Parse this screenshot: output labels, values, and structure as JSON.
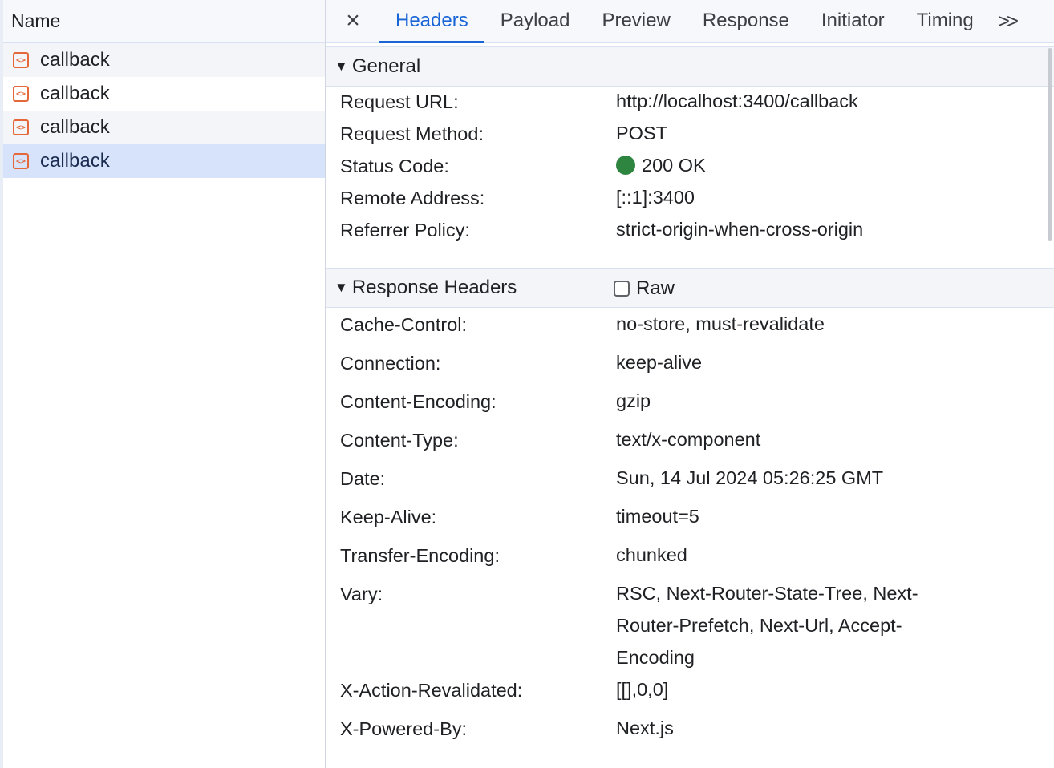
{
  "request_list": {
    "header": "Name",
    "items": [
      {
        "name": "callback",
        "icon": "document-icon"
      },
      {
        "name": "callback",
        "icon": "document-icon"
      },
      {
        "name": "callback",
        "icon": "document-icon"
      },
      {
        "name": "callback",
        "icon": "document-icon",
        "selected": true
      }
    ]
  },
  "tabs": {
    "close_icon": "×",
    "items": [
      "Headers",
      "Payload",
      "Preview",
      "Response",
      "Initiator",
      "Timing"
    ],
    "active": "Headers",
    "more_icon": ">>"
  },
  "general": {
    "title": "General",
    "rows": [
      {
        "key": "Request URL:",
        "value": "http://localhost:3400/callback"
      },
      {
        "key": "Request Method:",
        "value": "POST"
      },
      {
        "key": "Status Code:",
        "value": "200 OK",
        "status_color": "#2e8540"
      },
      {
        "key": "Remote Address:",
        "value": "[::1]:3400"
      },
      {
        "key": "Referrer Policy:",
        "value": "strict-origin-when-cross-origin"
      }
    ]
  },
  "response_headers": {
    "title": "Response Headers",
    "raw_label": "Raw",
    "raw_checked": false,
    "rows": [
      {
        "key": "Cache-Control:",
        "value": "no-store, must-revalidate"
      },
      {
        "key": "Connection:",
        "value": "keep-alive"
      },
      {
        "key": "Content-Encoding:",
        "value": "gzip"
      },
      {
        "key": "Content-Type:",
        "value": "text/x-component"
      },
      {
        "key": "Date:",
        "value": "Sun, 14 Jul 2024 05:26:25 GMT"
      },
      {
        "key": "Keep-Alive:",
        "value": "timeout=5"
      },
      {
        "key": "Transfer-Encoding:",
        "value": "chunked"
      },
      {
        "key": "Vary:",
        "value": "RSC, Next-Router-State-Tree, Next-Router-Prefetch, Next-Url, Accept-Encoding"
      },
      {
        "key": "X-Action-Revalidated:",
        "value": "[[],0,0]"
      },
      {
        "key": "X-Powered-By:",
        "value": "Next.js"
      }
    ]
  },
  "colors": {
    "accent": "#1a65d6",
    "selected_row": "#d6e3fb",
    "icon_orange": "#e5683a"
  }
}
